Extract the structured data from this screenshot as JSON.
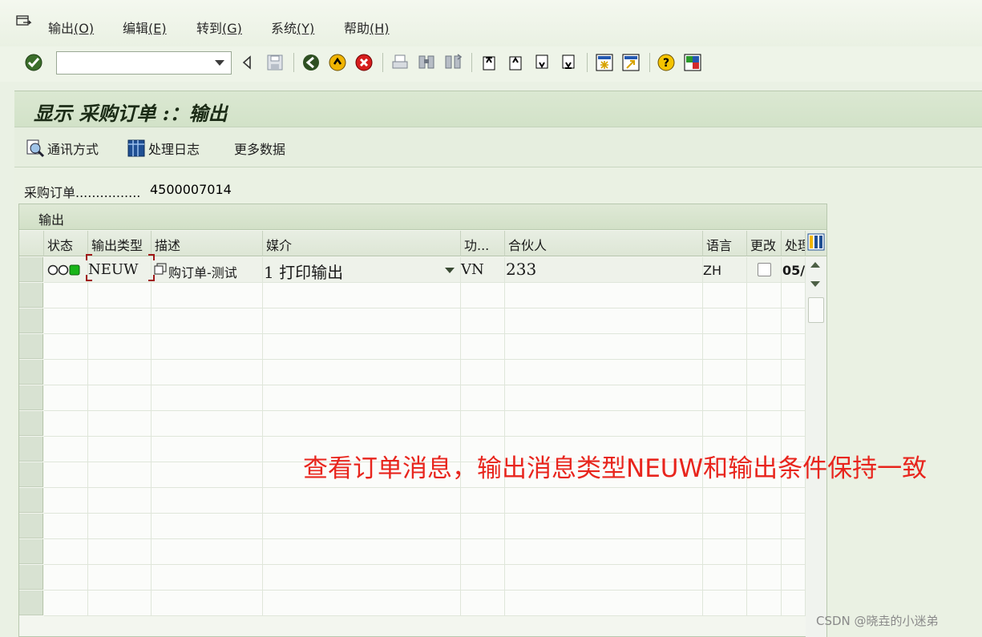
{
  "menu": {
    "items": [
      {
        "label": "输出",
        "key": "(O)"
      },
      {
        "label": "编辑",
        "key": "(E)"
      },
      {
        "label": "转到",
        "key": "(G)"
      },
      {
        "label": "系统",
        "key": "(Y)"
      },
      {
        "label": "帮助",
        "key": "(H)"
      }
    ]
  },
  "toolbar": {
    "command_value": "",
    "icons": [
      "enter-icon",
      "back-icon",
      "save-icon",
      "nav-back-icon",
      "exit-icon",
      "cancel-icon",
      "print-icon",
      "find-icon",
      "find-next-icon",
      "first-page-icon",
      "prev-page-icon",
      "next-page-icon",
      "last-page-icon",
      "new-session-icon",
      "shortcut-icon",
      "help-icon",
      "layout-icon"
    ]
  },
  "page": {
    "title": "显示 采购订单 :：输出"
  },
  "appbar": {
    "btn_communication": "通讯方式",
    "btn_log": "处理日志",
    "btn_more": "更多数据"
  },
  "header_fields": {
    "po_label": "采购订单................",
    "po_value": "4500007014"
  },
  "panel": {
    "title": "输出",
    "columns": [
      "状态",
      "输出类型",
      "描述",
      "媒介",
      "功...",
      "合伙人",
      "语言",
      "更改",
      "处理"
    ],
    "rows": [
      {
        "type": "NEUW",
        "desc": "购订单-测试",
        "medium": "1  打印输出",
        "func": "VN",
        "partner": "233",
        "lang": "ZH",
        "changed": false,
        "processed": "05/"
      }
    ]
  },
  "annotation": "查看订单消息，输出消息类型NEUW和输出条件保持一致",
  "watermark": "CSDN @晓垚的小迷弟",
  "colors": {
    "annotation": "#e8251d",
    "background": "#eaf1e4",
    "status_active": "#18b518"
  }
}
